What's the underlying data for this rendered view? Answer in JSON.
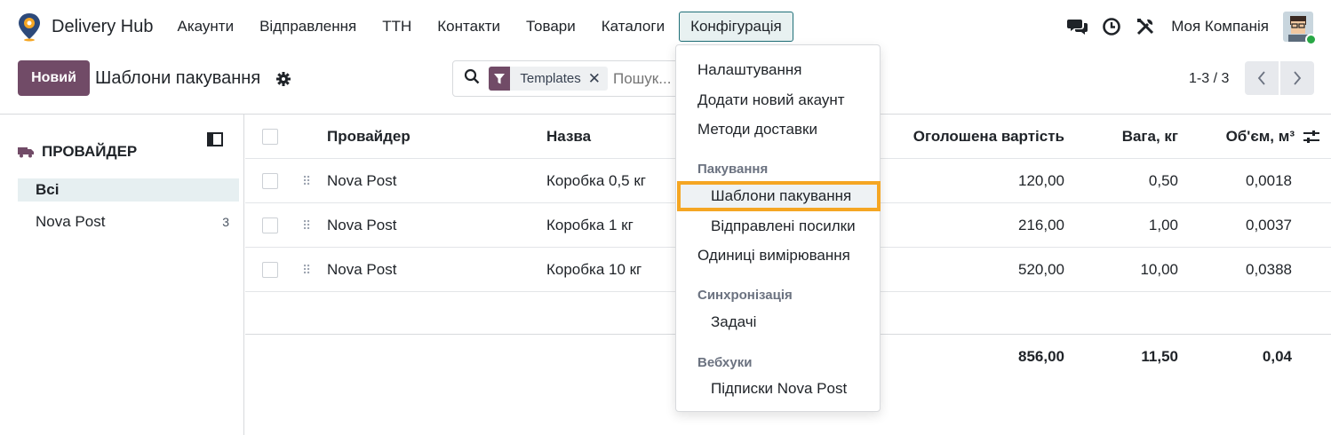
{
  "app": {
    "name": "Delivery Hub"
  },
  "nav": {
    "items": [
      "Акаунти",
      "Відправлення",
      "ТТН",
      "Контакти",
      "Товари",
      "Каталоги",
      "Конфігурація"
    ],
    "company": "Моя Компанія"
  },
  "control": {
    "new_label": "Новий",
    "title": "Шаблони пакування",
    "facet_label": "Templates",
    "search_placeholder": "Пошук...",
    "pager": "1-3 / 3"
  },
  "sidebar": {
    "header": "ПРОВАЙДЕР",
    "items": [
      {
        "label": "Всі",
        "count": ""
      },
      {
        "label": "Nova Post",
        "count": "3"
      }
    ]
  },
  "table": {
    "columns": [
      "Провайдер",
      "Назва",
      "Оголошена вартість",
      "Вага, кг",
      "Об'єм, м³"
    ],
    "rows": [
      {
        "provider": "Nova Post",
        "name": "Коробка 0,5 кг",
        "value": "120,00",
        "weight": "0,50",
        "volume": "0,0018"
      },
      {
        "provider": "Nova Post",
        "name": "Коробка 1 кг",
        "value": "216,00",
        "weight": "1,00",
        "volume": "0,0037"
      },
      {
        "provider": "Nova Post",
        "name": "Коробка 10 кг",
        "value": "520,00",
        "weight": "10,00",
        "volume": "0,0388"
      }
    ],
    "totals": {
      "value": "856,00",
      "weight": "11,50",
      "volume": "0,04"
    }
  },
  "dropdown": {
    "items": [
      {
        "label": "Налаштування"
      },
      {
        "label": "Додати новий акаунт"
      },
      {
        "label": "Методи доставки"
      }
    ],
    "sections": [
      {
        "title": "Пакування",
        "items": [
          "Шаблони пакування",
          "Відправлені посилки"
        ]
      },
      {
        "title": "Синхронізація",
        "items": [
          "Задачі"
        ]
      },
      {
        "title": "Вебхуки",
        "items": [
          "Підписки Nova Post"
        ]
      }
    ],
    "standalone": "Одиниці вимірювання",
    "highlighted": "Шаблони пакування"
  },
  "colors": {
    "primary": "#714b67",
    "accent": "#1f6f78",
    "highlight": "#f5a623"
  }
}
